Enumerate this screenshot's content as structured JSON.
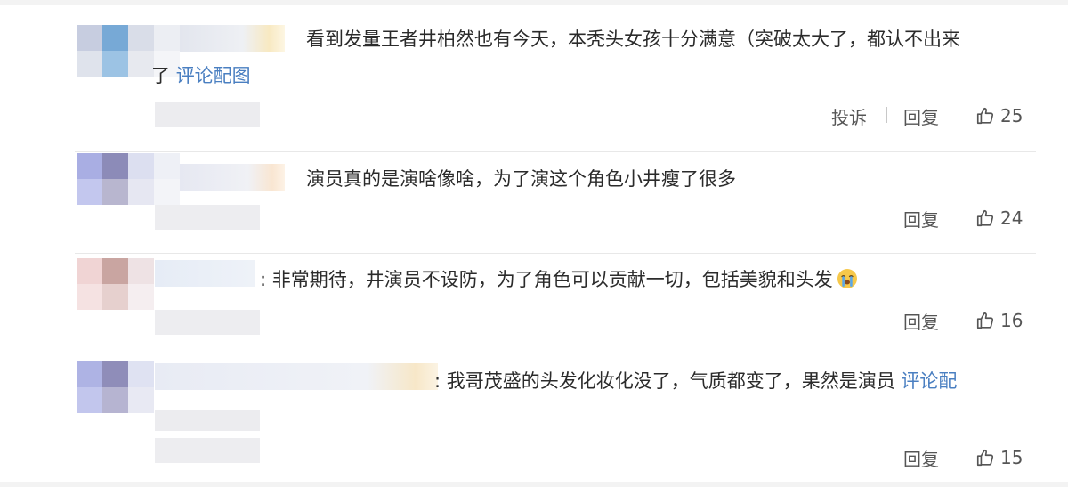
{
  "comments": [
    {
      "text_line1": "看到发量王者井柏然也有今天，本秃头女孩十分满意（突破太大了，都认不出来",
      "text_line2_prefix": "了 ",
      "link": "评论配图",
      "actions": [
        "投诉",
        "回复"
      ],
      "likes": "25"
    },
    {
      "text_line1": "演员真的是演啥像啥，为了演这个角色小井瘦了很多",
      "actions": [
        "回复"
      ],
      "likes": "24"
    },
    {
      "text_line1": ":  非常期待，井演员不设防，为了角色可以贡献一切，包括美貌和头发",
      "emoji": "crying-face-emoji",
      "actions": [
        "回复"
      ],
      "likes": "16"
    },
    {
      "text_line1": ":  我哥茂盛的头发化妆化没了，气质都变了，果然是演员 ",
      "link": "评论配",
      "actions": [
        "回复"
      ],
      "likes": "15"
    }
  ],
  "colors": {
    "link": "#4a7fc1",
    "text": "#2b2b2b",
    "action": "#555555",
    "divider": "#e8e8e8"
  }
}
